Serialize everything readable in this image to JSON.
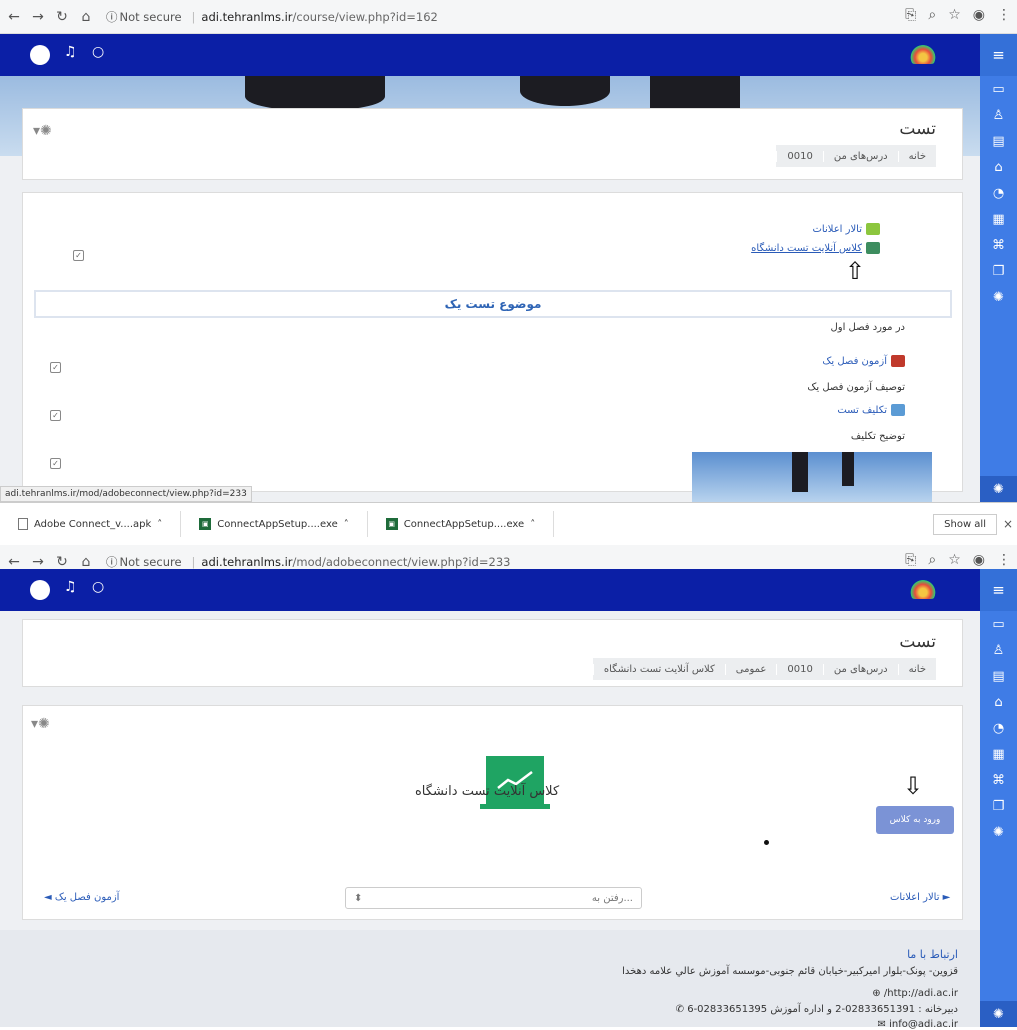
{
  "browser1": {
    "url_ns": "Not secure",
    "url_host": "adi.tehranlms.ir",
    "url_path": "/course/view.php?id=162"
  },
  "browser2": {
    "url_ns": "Not secure",
    "url_host": "adi.tehranlms.ir",
    "url_path": "/mod/adobeconnect/view.php?id=233"
  },
  "course": {
    "title": "تست",
    "crumbs1": [
      "خانه",
      "درس‌های من",
      "0010"
    ],
    "crumbs2": [
      "خانه",
      "درس‌های من",
      "0010",
      "عمومی",
      "کلاس آنلایت تست دانشگاه"
    ]
  },
  "activities": {
    "forum": "تالار اعلانات",
    "online_class": "کلاس آنلایت تست دانشگاه",
    "topic_title": "موضوع تست یک",
    "topic_summary": "در مورد فصل اول",
    "quiz": "آزمون فصل یک",
    "quiz_desc": "توصیف آزمون فصل یک",
    "assign": "تکلیف تست",
    "assign_desc": "توضیح تکلیف"
  },
  "status_url": "adi.tehranlms.ir/mod/adobeconnect/view.php?id=233",
  "downloads": {
    "items": [
      "Adobe Connect_v....apk",
      "ConnectAppSetup....exe",
      "ConnectAppSetup....exe"
    ],
    "show_all": "Show all"
  },
  "adobe": {
    "title": "کلاس آنلایت تست دانشگاه",
    "enter_button": "ورود به کلاس",
    "prev_link": "تالار اعلانات",
    "next_link": "آزمون فصل یک",
    "jump_placeholder": "رفتن به..."
  },
  "footer": {
    "heading": "ارتباط با ما",
    "address": "قزوین- پونک-بلوار امیرکبیر-خیابان قائم جنوبی-موسسه آموزش عالي علامه دهخدا",
    "website": "http://adi.ac.ir/",
    "phone": "دبیرخانه : 02833651391-2 و اداره آموزش 02833651395-6",
    "email": "info@adi.ac.ir"
  },
  "colors": {
    "topbar": "#0b1fa6",
    "sidebar": "#3f7ce6",
    "link": "#2a5bb8",
    "adobe_green": "#1fa463"
  }
}
